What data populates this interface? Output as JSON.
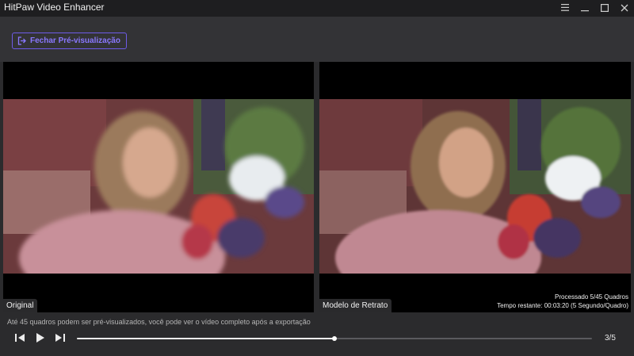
{
  "window": {
    "title": "HitPaw Video Enhancer"
  },
  "toolbar": {
    "close_preview_label": "Fechar Pré-visualização"
  },
  "preview": {
    "left_label": "Original",
    "right_label": "Modelo de Retrato",
    "status_processed": "Processado 5/45 Quadros",
    "status_remaining": "Tempo restante: 00:03:20 (5 Segundo/Quadro)"
  },
  "bottom": {
    "info_text": "Até 45 quadros podem ser pré-visualizados, você pode ver o vídeo completo após a exportação",
    "frame_counter": "3/5",
    "progress_fraction": 0.5
  },
  "colors": {
    "accent": "#8a78ff",
    "background": "#2b2b2d",
    "titlebar": "#1e1e20"
  }
}
